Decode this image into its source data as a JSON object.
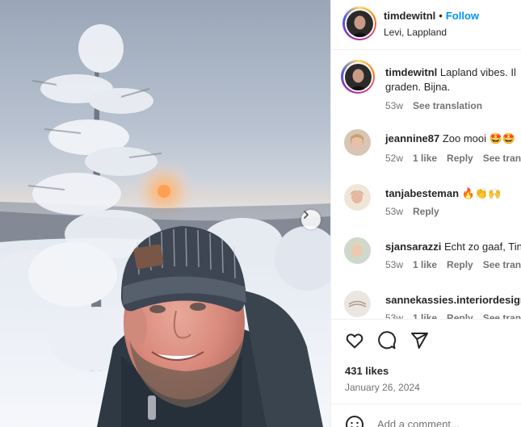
{
  "post": {
    "username": "timdewitnl",
    "separator": "•",
    "follow_label": "Follow",
    "location": "Levi, Lappland"
  },
  "caption": {
    "username": "timdewitnl",
    "text": "Lapland vibes. Il",
    "text_line2": "graden. Bijna.",
    "time": "53w",
    "see_translation": "See translation"
  },
  "comments": [
    {
      "username": "jeannine87",
      "text": "Zoo mooi 🤩🤩",
      "time": "52w",
      "likes": "1 like",
      "reply": "Reply",
      "translate": "See transl"
    },
    {
      "username": "tanjabesteman",
      "text": "🔥👏🙌",
      "time": "53w",
      "reply": "Reply"
    },
    {
      "username": "sjansarazzi",
      "text": "Echt zo gaaf, Tin",
      "time": "53w",
      "likes": "1 like",
      "reply": "Reply",
      "translate": "See transl"
    },
    {
      "username": "sannekassies.interiordesign",
      "text": "",
      "time": "53w",
      "likes": "1 like",
      "reply": "Reply",
      "translate": "See transl"
    }
  ],
  "footer": {
    "likes": "431 likes",
    "date": "January 26, 2024",
    "add_comment_placeholder": "Add a comment..."
  },
  "icons": {
    "next": "chevron-right-icon",
    "like": "heart-icon",
    "comment": "comment-bubble-icon",
    "share": "paper-plane-icon",
    "emoji": "smiley-icon"
  },
  "colors": {
    "follow": "#0095f6",
    "meta": "#737373",
    "text": "#262626"
  }
}
